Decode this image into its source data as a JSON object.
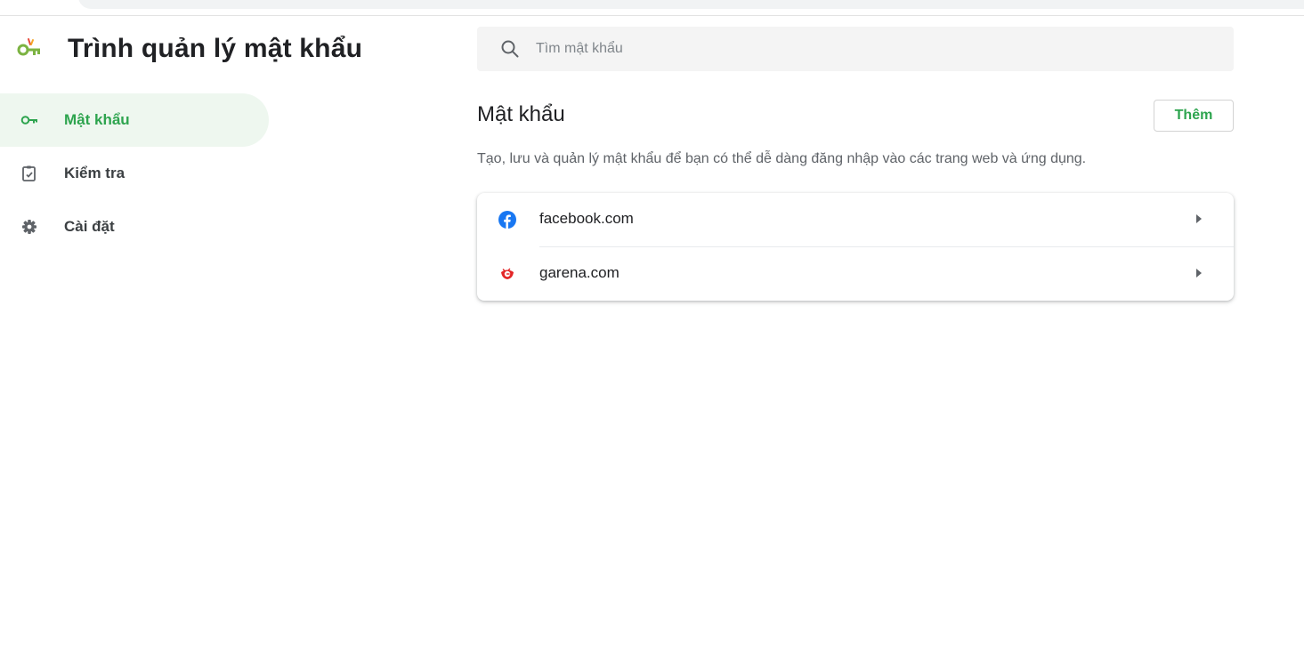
{
  "app": {
    "title": "Trình quản lý mật khẩu",
    "logo_icon": "password-manager-key-icon",
    "accent": "#2da44e"
  },
  "sidebar": {
    "items": [
      {
        "label": "Mật khẩu",
        "icon": "key-icon",
        "active": true
      },
      {
        "label": "Kiểm tra",
        "icon": "checkup-clipboard-icon",
        "active": false
      },
      {
        "label": "Cài đặt",
        "icon": "gear-icon",
        "active": false
      }
    ]
  },
  "search": {
    "placeholder": "Tìm mật khẩu",
    "value": ""
  },
  "main": {
    "title": "Mật khẩu",
    "add_label": "Thêm",
    "description": "Tạo, lưu và quản lý mật khẩu để bạn có thể dễ dàng đăng nhập vào các trang web và ứng dụng.",
    "passwords": [
      {
        "site": "facebook.com",
        "icon": "facebook-icon",
        "color": "#1877f2"
      },
      {
        "site": "garena.com",
        "icon": "garena-icon",
        "color": "#e32526"
      }
    ]
  }
}
